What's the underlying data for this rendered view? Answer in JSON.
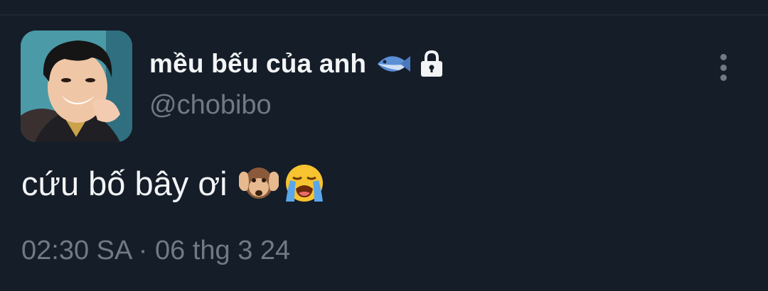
{
  "tweet": {
    "display_name": "mều bếu của anh",
    "handle": "@chobibo",
    "text": "cứu bố bây ơi",
    "timestamp": "02:30 SA · 06 thg 3 24",
    "icons": {
      "name_emoji": "fish-icon",
      "protected": "lock-icon",
      "more": "more-vertical-icon",
      "text_emojis": [
        "hear-no-evil-monkey-icon",
        "loudly-crying-face-icon"
      ]
    }
  },
  "colors": {
    "background": "#151d28",
    "primary_text": "#f2f4f6",
    "secondary_text": "#6f7a86"
  }
}
